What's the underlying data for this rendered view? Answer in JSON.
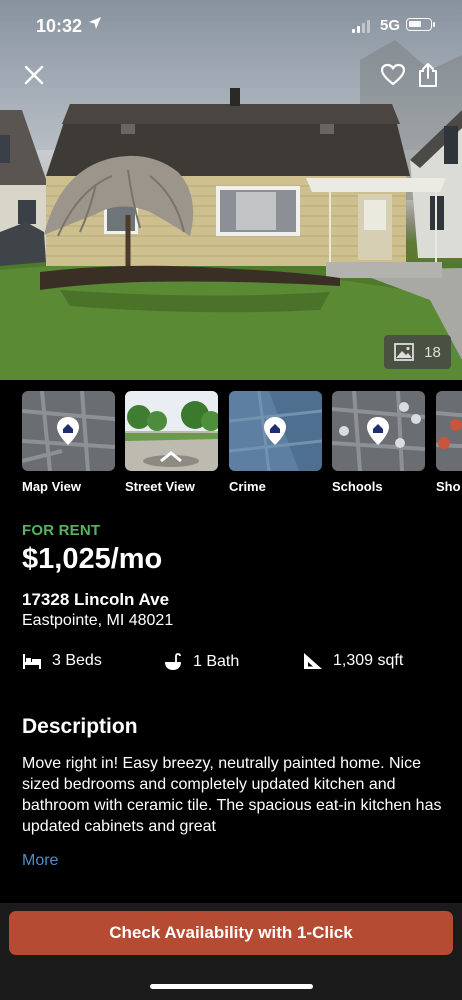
{
  "status_bar": {
    "time": "10:32",
    "network": "5G"
  },
  "hero": {
    "photo_count": "18"
  },
  "map_tiles": [
    {
      "label": "Map View"
    },
    {
      "label": "Street View"
    },
    {
      "label": "Crime"
    },
    {
      "label": "Schools"
    },
    {
      "label": "Sho"
    }
  ],
  "listing": {
    "status": "FOR RENT",
    "price": "$1,025/mo",
    "address_line1": "17328 Lincoln Ave",
    "address_line2": "Eastpointe, MI 48021",
    "beds": "3 Beds",
    "baths": "1 Bath",
    "sqft": "1,309 sqft"
  },
  "description": {
    "title": "Description",
    "body": "Move right in! Easy breezy, neutrally painted home. Nice sized bedrooms and completely updated kitchen and bathroom with ceramic tile. The spacious eat-in kitchen has updated cabinets and great",
    "more_label": "More"
  },
  "cta": {
    "label": "Check Availability with 1-Click"
  },
  "colors": {
    "for_rent": "#57b35f",
    "cta": "#b54b33",
    "link": "#4f8fc9"
  }
}
